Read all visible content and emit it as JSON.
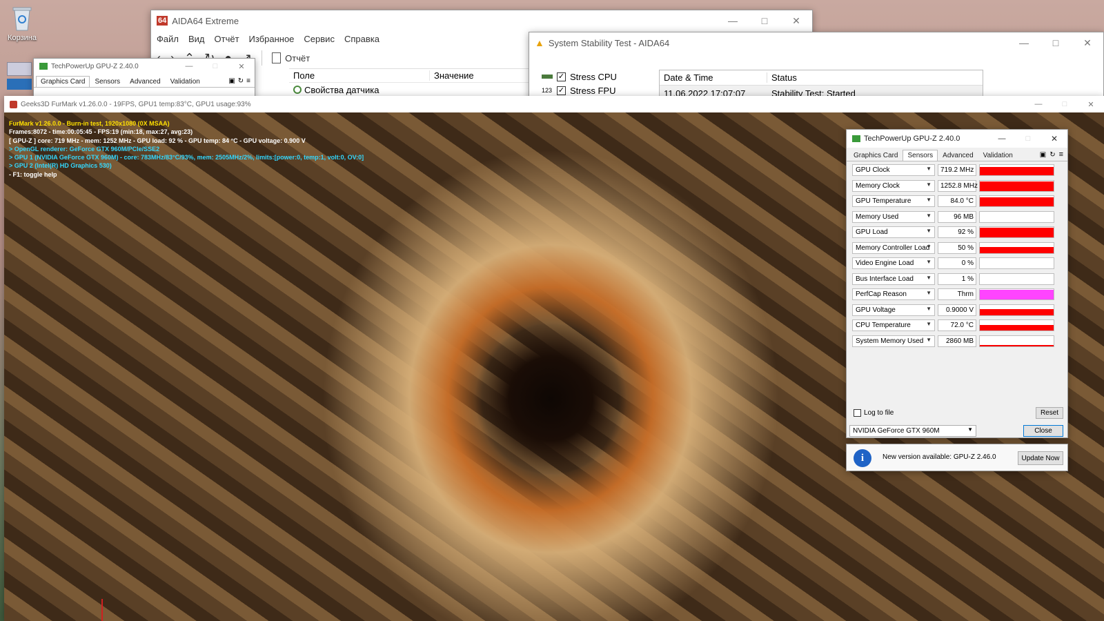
{
  "desktop": {
    "recycle_bin_label": "Корзина"
  },
  "aida": {
    "title": "AIDA64 Extreme",
    "logo_text": "64",
    "menu": [
      "Файл",
      "Вид",
      "Отчёт",
      "Избранное",
      "Сервис",
      "Справка"
    ],
    "report_label": "Отчёт",
    "col_field": "Поле",
    "col_value": "Значение",
    "row1": "Свойства датчика"
  },
  "stability": {
    "title": "System Stability Test - AIDA64",
    "stress_cpu": "Stress CPU",
    "stress_fpu": "Stress FPU",
    "col_datetime": "Date & Time",
    "col_status": "Status",
    "row_datetime": "11.06.2022 17:07:07",
    "row_status": "Stability Test: Started"
  },
  "gpuz_small": {
    "title": "TechPowerUp GPU-Z 2.40.0",
    "tabs": [
      "Graphics Card",
      "Sensors",
      "Advanced",
      "Validation"
    ]
  },
  "furmark": {
    "title": "Geeks3D FurMark v1.26.0.0 - 19FPS, GPU1 temp:83°C, GPU1 usage:93%",
    "lines": [
      "FurMark v1.26.0.0 - Burn-in test, 1920x1080 (0X MSAA)",
      "Frames:8072 - time:00:05:45 - FPS:19 (min:18, max:27, avg:23)",
      "[ GPU-Z ] core: 719 MHz - mem: 1252 MHz - GPU load: 92 % - GPU temp: 84 °C - GPU voltage: 0.900 V",
      "> OpenGL renderer: GeForce GTX 960M/PCIe/SSE2",
      "> GPU 1 (NVIDIA GeForce GTX 960M) - core: 783MHz/83°C/93%, mem: 2505MHz/2%, limits:[power:0, temp:1, volt:0, OV:0]",
      "> GPU 2 (Intel(R) HD Graphics 530)",
      "- F1: toggle help"
    ],
    "line_colors": [
      "#ffe000",
      "#ffffff",
      "#ffffff",
      "#33d8ff",
      "#33d8ff",
      "#33d8ff",
      "#ffffff"
    ]
  },
  "gpuz": {
    "title": "TechPowerUp GPU-Z 2.40.0",
    "tabs": [
      "Graphics Card",
      "Sensors",
      "Advanced",
      "Validation"
    ],
    "active_tab": "Sensors",
    "sensors": [
      {
        "name": "GPU Clock",
        "value": "719.2 MHz",
        "color": "#ff0000",
        "level": 0.8
      },
      {
        "name": "Memory Clock",
        "value": "1252.8 MHz",
        "color": "#ff0000",
        "level": 0.95
      },
      {
        "name": "GPU Temperature",
        "value": "84.0 °C",
        "color": "#ff0000",
        "level": 0.85
      },
      {
        "name": "Memory Used",
        "value": "96 MB",
        "color": "#ff0000",
        "level": 0.0
      },
      {
        "name": "GPU Load",
        "value": "92 %",
        "color": "#ff0000",
        "level": 0.92
      },
      {
        "name": "Memory Controller Load",
        "value": "50 %",
        "color": "#ff0000",
        "level": 0.6
      },
      {
        "name": "Video Engine Load",
        "value": "0 %",
        "color": "#ff0000",
        "level": 0.0
      },
      {
        "name": "Bus Interface Load",
        "value": "1 %",
        "color": "#ff0000",
        "level": 0.02
      },
      {
        "name": "PerfCap Reason",
        "value": "Thrm",
        "color": "#ff44ff",
        "level": 0.9
      },
      {
        "name": "GPU Voltage",
        "value": "0.9000 V",
        "color": "#ff0000",
        "level": 0.6
      },
      {
        "name": "CPU Temperature",
        "value": "72.0 °C",
        "color": "#ff0000",
        "level": 0.55
      },
      {
        "name": "System Memory Used",
        "value": "2860 MB",
        "color": "#ff0000",
        "level": 0.15
      }
    ],
    "log_to_file": "Log to file",
    "reset": "Reset",
    "device": "NVIDIA GeForce GTX 960M",
    "close": "Close",
    "update_msg": "New version available: GPU-Z 2.46.0",
    "update_btn": "Update Now"
  }
}
